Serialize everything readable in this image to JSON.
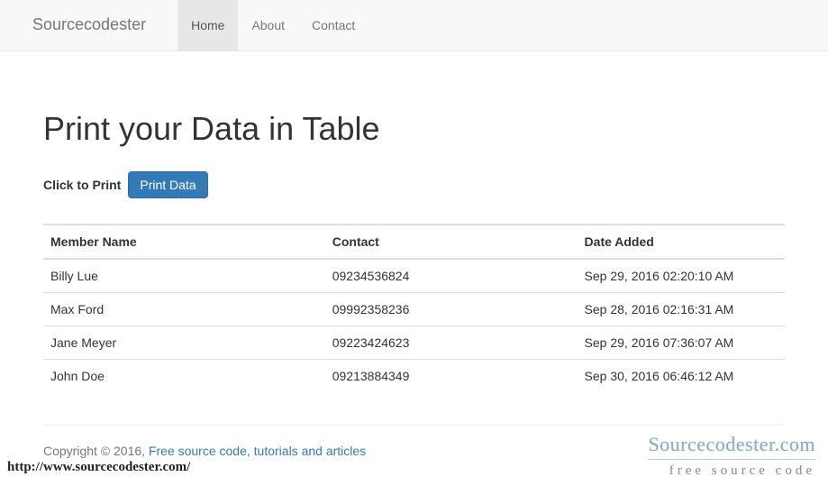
{
  "navbar": {
    "brand": "Sourcecodester",
    "items": [
      "Home",
      "About",
      "Contact"
    ],
    "activeIndex": 0
  },
  "page": {
    "title": "Print your Data in Table",
    "printLabel": "Click to Print",
    "printButton": "Print Data"
  },
  "table": {
    "headers": [
      "Member Name",
      "Contact",
      "Date Added"
    ],
    "rows": [
      {
        "name": "Billy Lue",
        "contact": "09234536824",
        "date": "Sep 29, 2016 02:20:10 AM"
      },
      {
        "name": "Max Ford",
        "contact": "09992358236",
        "date": "Sep 28, 2016 02:16:31 AM"
      },
      {
        "name": "Jane Meyer",
        "contact": "09223424623",
        "date": "Sep 29, 2016 07:36:07 AM"
      },
      {
        "name": "John Doe",
        "contact": "09213884349",
        "date": "Sep 30, 2016 06:46:12 AM"
      }
    ]
  },
  "footer": {
    "copyright": "Copyright © 2016, ",
    "linkText": "Free source code, tutorials and articles"
  },
  "watermark": {
    "url": "http://www.sourcecodester.com/",
    "logoLine1": "Sourcecodester.com",
    "logoLine2": "free source code"
  }
}
